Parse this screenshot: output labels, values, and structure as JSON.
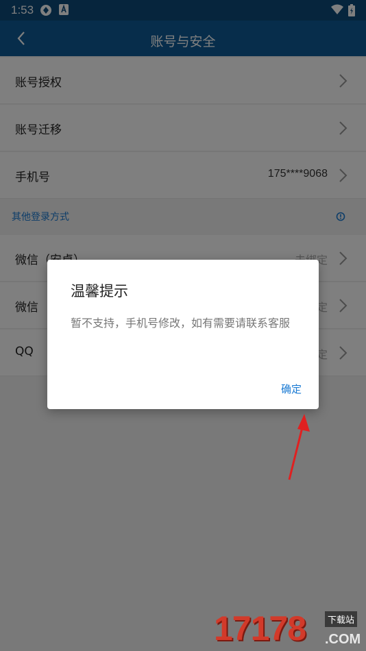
{
  "status_bar": {
    "time": "1:53"
  },
  "header": {
    "title": "账号与安全"
  },
  "rows": [
    {
      "label": "账号授权",
      "value": ""
    },
    {
      "label": "账号迁移",
      "value": ""
    },
    {
      "label": "手机号",
      "value": "175****9068"
    }
  ],
  "section": {
    "label": "其他登录方式"
  },
  "login_rows": [
    {
      "label": "微信（安卓）",
      "value": "未绑定"
    },
    {
      "label": "微信",
      "value": "未绑定"
    },
    {
      "label": "QQ",
      "value": "未绑定"
    }
  ],
  "dialog": {
    "title": "温馨提示",
    "message": "暂不支持，手机号修改，如有需要请联系客服",
    "confirm_label": "确定"
  },
  "watermark": {
    "number": "17178",
    "site_cn": "下载站",
    "domain": ".COM"
  },
  "colors": {
    "header": "#0f5b96",
    "status_bar": "#0c4a7b",
    "accent": "#1a7ad3",
    "annotation_arrow": "#e02020"
  }
}
